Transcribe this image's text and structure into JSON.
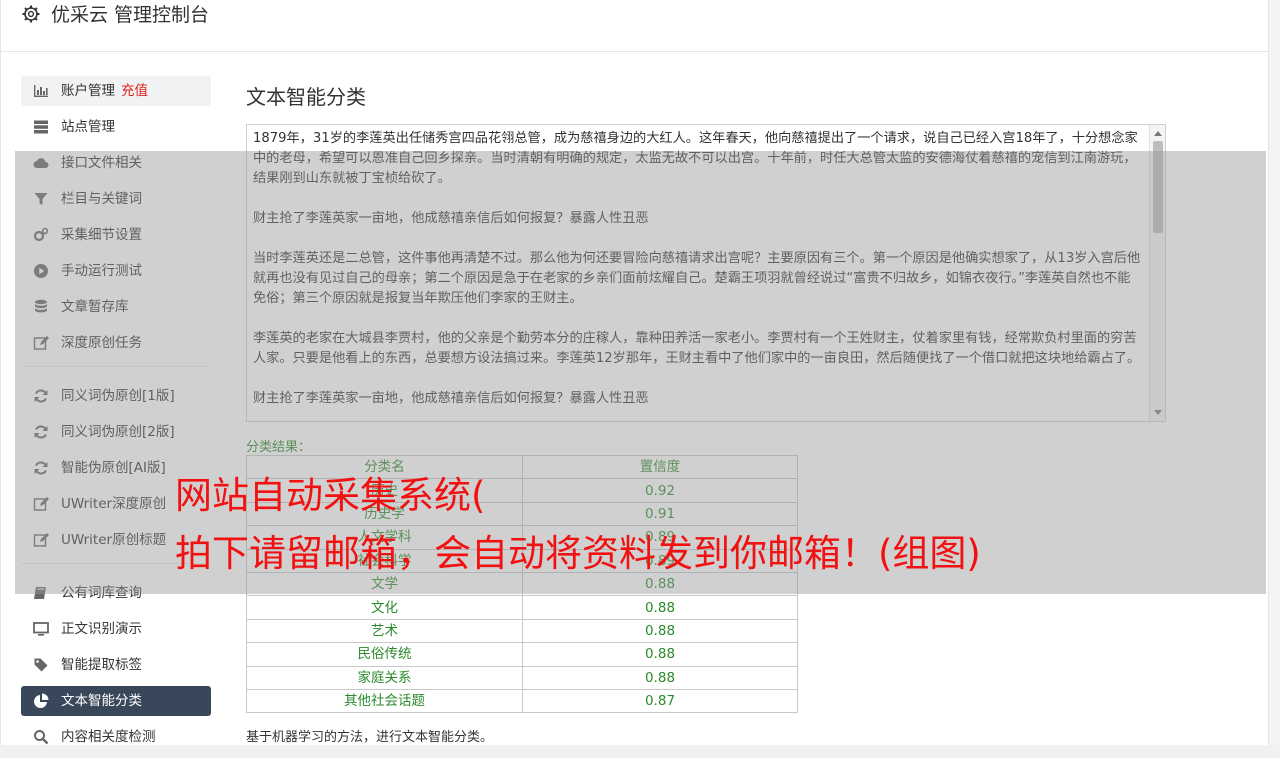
{
  "header": {
    "title": "优采云 管理控制台",
    "icon": "gear-icon"
  },
  "sidebar": {
    "items": [
      {
        "label": "账户管理",
        "badge": "充值",
        "icon": "bar-chart-icon"
      },
      {
        "label": "站点管理",
        "icon": "server-icon"
      },
      {
        "label": "接口文件相关",
        "icon": "cloud-icon"
      },
      {
        "label": "栏目与关键词",
        "icon": "filter-icon"
      },
      {
        "label": "采集细节设置",
        "icon": "gears-icon"
      },
      {
        "label": "手动运行测试",
        "icon": "play-circle-icon"
      },
      {
        "label": "文章暂存库",
        "icon": "database-icon"
      },
      {
        "label": "深度原创任务",
        "icon": "edit-icon"
      },
      {
        "label": "同义词伪原创[1版]",
        "icon": "refresh-icon"
      },
      {
        "label": "同义词伪原创[2版]",
        "icon": "refresh-icon"
      },
      {
        "label": "智能伪原创[AI版]",
        "icon": "refresh-icon"
      },
      {
        "label": "UWriter深度原创",
        "icon": "edit-icon"
      },
      {
        "label": "UWriter原创标题",
        "icon": "edit-icon"
      },
      {
        "label": "公有词库查询",
        "icon": "book-icon"
      },
      {
        "label": "正文识别演示",
        "icon": "monitor-icon"
      },
      {
        "label": "智能提取标签",
        "icon": "tag-icon"
      },
      {
        "label": "文本智能分类",
        "icon": "pie-chart-icon"
      },
      {
        "label": "内容相关度检测",
        "icon": "search-icon"
      }
    ]
  },
  "main": {
    "title": "文本智能分类",
    "paragraphs": [
      "1879年，31岁的李莲英出任储秀宫四品花翎总管，成为慈禧身边的大红人。这年春天，他向慈禧提出了一个请求，说自己已经入宫18年了，十分想念家中的老母，希望可以恩准自己回乡探亲。当时清朝有明确的规定，太监无故不可以出宫。十年前，时任大总管太监的安德海仗着慈禧的宠信到江南游玩，结果刚到山东就被丁宝桢给砍了。",
      "财主抢了李莲英家一亩地，他成慈禧亲信后如何报复？暴露人性丑恶",
      "当时李莲英还是二总管，这件事他再清楚不过。那么他为何还要冒险向慈禧请求出宫呢？主要原因有三个。第一个原因是他确实想家了，从13岁入宫后他就再也没有见过自己的母亲；第二个原因是急于在老家的乡亲们面前炫耀自己。楚霸王项羽就曾经说过“富贵不归故乡，如锦衣夜行。”李莲英自然也不能免俗；第三个原因就是报复当年欺压他们李家的王财主。",
      "李莲英的老家在大城县李贾村，他的父亲是个勤劳本分的庄稼人，靠种田养活一家老小。李贾村有一个王姓财主，仗着家里有钱，经常欺负村里面的穷苦人家。只要是他看上的东西，总要想方设法搞过来。李莲英12岁那年，王财主看中了他们家中的一亩良田，然后随便找了一个借口就把这块地给霸占了。",
      "财主抢了李莲英家一亩地，他成慈禧亲信后如何报复？暴露人性丑恶"
    ],
    "result_label": "分类结果：",
    "table": {
      "headers": [
        "分类名",
        "置信度"
      ],
      "rows": [
        [
          "历史",
          "0.92"
        ],
        [
          "历史学",
          "0.91"
        ],
        [
          "人文学科",
          "0.89"
        ],
        [
          "社会科学",
          "0.89"
        ],
        [
          "文学",
          "0.88"
        ],
        [
          "文化",
          "0.88"
        ],
        [
          "艺术",
          "0.88"
        ],
        [
          "民俗传统",
          "0.88"
        ],
        [
          "家庭关系",
          "0.88"
        ],
        [
          "其他社会话题",
          "0.87"
        ]
      ]
    },
    "footnote": "基于机器学习的方法，进行文本智能分类。"
  },
  "overlay": {
    "line1": "网站自动采集系统(",
    "line2": "拍下请留邮箱，会自动将资料发到你邮箱！(组图)",
    "color": "#f21010"
  }
}
